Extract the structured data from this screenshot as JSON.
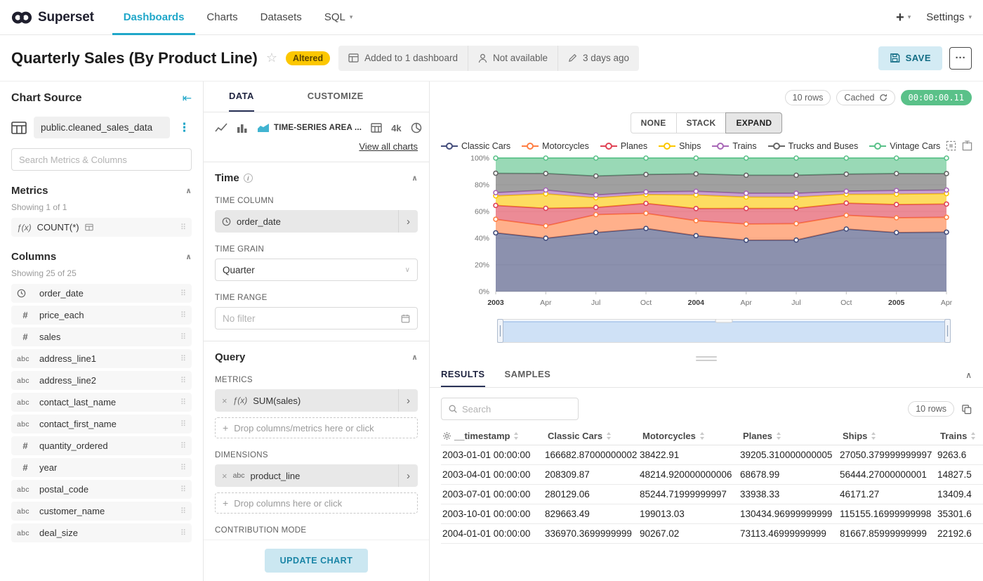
{
  "navbar": {
    "brand": "Superset",
    "items": [
      {
        "label": "Dashboards",
        "active": true
      },
      {
        "label": "Charts",
        "active": false
      },
      {
        "label": "Datasets",
        "active": false
      },
      {
        "label": "SQL",
        "active": false,
        "caret": true
      }
    ],
    "settings_label": "Settings"
  },
  "header": {
    "title": "Quarterly Sales (By Product Line)",
    "altered_badge": "Altered",
    "dashboard_info": "Added to 1 dashboard",
    "availability": "Not available",
    "last_modified": "3 days ago",
    "save_label": "SAVE",
    "more_label": "···"
  },
  "datasource_panel": {
    "title": "Chart Source",
    "dataset_name": "public.cleaned_sales_data",
    "search_placeholder": "Search Metrics & Columns",
    "metrics": {
      "title": "Metrics",
      "showing": "Showing 1 of 1",
      "items": [
        {
          "label": "COUNT(*)"
        }
      ]
    },
    "columns": {
      "title": "Columns",
      "showing": "Showing 25 of 25",
      "items": [
        {
          "name": "order_date",
          "type": "time"
        },
        {
          "name": "price_each",
          "type": "number"
        },
        {
          "name": "sales",
          "type": "number"
        },
        {
          "name": "address_line1",
          "type": "text"
        },
        {
          "name": "address_line2",
          "type": "text"
        },
        {
          "name": "contact_last_name",
          "type": "text"
        },
        {
          "name": "contact_first_name",
          "type": "text"
        },
        {
          "name": "quantity_ordered",
          "type": "number"
        },
        {
          "name": "year",
          "type": "number"
        },
        {
          "name": "postal_code",
          "type": "text"
        },
        {
          "name": "customer_name",
          "type": "text"
        },
        {
          "name": "deal_size",
          "type": "text"
        }
      ]
    }
  },
  "controls_panel": {
    "tabs": [
      "DATA",
      "CUSTOMIZE"
    ],
    "viz_selector": {
      "selected_label": "TIME-SERIES AREA ...",
      "kpi_label": "4k",
      "view_all": "View all charts"
    },
    "time_section": {
      "title": "Time",
      "time_column_label": "TIME COLUMN",
      "time_column_value": "order_date",
      "time_grain_label": "TIME GRAIN",
      "time_grain_value": "Quarter",
      "time_range_label": "TIME RANGE",
      "time_range_value": "No filter"
    },
    "query_section": {
      "title": "Query",
      "metrics_label": "METRICS",
      "metric_value": "SUM(sales)",
      "metrics_dropzone": "Drop columns/metrics here or click",
      "dimensions_label": "DIMENSIONS",
      "dimension_value": "product_line",
      "dimensions_dropzone": "Drop columns here or click",
      "contribution_label": "CONTRIBUTION MODE"
    },
    "update_chart_label": "UPDATE CHART"
  },
  "chart_panel": {
    "rows_badge": "10 rows",
    "cached_badge": "Cached",
    "timer": "00:00:00.11",
    "stack_controls": [
      {
        "label": "NONE",
        "active": false
      },
      {
        "label": "STACK",
        "active": false
      },
      {
        "label": "EXPAND",
        "active": true
      }
    ]
  },
  "results_panel": {
    "tabs": [
      "RESULTS",
      "SAMPLES"
    ],
    "search_placeholder": "Search",
    "rows_badge": "10 rows",
    "table": {
      "headers": [
        "__timestamp",
        "Classic Cars",
        "Motorcycles",
        "Planes",
        "Ships",
        "Trains"
      ],
      "rows": [
        [
          "2003-01-01 00:00:00",
          "166682.87000000002",
          "38422.91",
          "39205.310000000005",
          "27050.379999999997",
          "9263.6"
        ],
        [
          "2003-04-01 00:00:00",
          "208309.87",
          "48214.920000000006",
          "68678.99",
          "56444.27000000001",
          "14827.5"
        ],
        [
          "2003-07-01 00:00:00",
          "280129.06",
          "85244.71999999997",
          "33938.33",
          "46171.27",
          "13409.4"
        ],
        [
          "2003-10-01 00:00:00",
          "829663.49",
          "199013.03",
          "130434.96999999999",
          "115155.16999999998",
          "35301.6"
        ],
        [
          "2004-01-01 00:00:00",
          "336970.3699999999",
          "90267.02",
          "73113.46999999999",
          "81667.85999999999",
          "22192.6"
        ]
      ]
    }
  },
  "chart_data": {
    "type": "area",
    "stacking": "expand",
    "x_tick_labels": [
      "2003",
      "Apr",
      "Jul",
      "Oct",
      "2004",
      "Apr",
      "Jul",
      "Oct",
      "2005",
      "Apr"
    ],
    "y_ticks": [
      0,
      20,
      40,
      60,
      80,
      100
    ],
    "y_unit": "%",
    "ylim": [
      0,
      100
    ],
    "legend_position": "top",
    "grid": true,
    "series": [
      {
        "name": "Classic Cars",
        "color": "#454e7c",
        "values": [
          166682.87,
          208309.87,
          280129.06,
          829663.49,
          336970.37,
          270000,
          285000,
          820000,
          400000,
          344000
        ]
      },
      {
        "name": "Motorcycles",
        "color": "#ff7f44",
        "values": [
          38422.91,
          48214.92,
          85244.72,
          199013.03,
          90267.02,
          85000,
          91000,
          180000,
          100000,
          86000
        ]
      },
      {
        "name": "Planes",
        "color": "#e04355",
        "values": [
          39205.31,
          68678.99,
          33938.33,
          130434.97,
          73113.47,
          82000,
          85000,
          160000,
          90000,
          77000
        ]
      },
      {
        "name": "Ships",
        "color": "#fcc700",
        "values": [
          27050.38,
          56444.27,
          46171.27,
          115155.17,
          81667.86,
          60000,
          62000,
          115000,
          70000,
          60000
        ]
      },
      {
        "name": "Trains",
        "color": "#a868b7",
        "values": [
          9263.6,
          14827.5,
          13409.4,
          35301.6,
          22192.6,
          20000,
          21000,
          40000,
          25000,
          21000
        ]
      },
      {
        "name": "Trucks and Buses",
        "color": "#666666",
        "values": [
          55000,
          65000,
          90000,
          230000,
          105000,
          95000,
          100000,
          225000,
          115000,
          95000
        ]
      },
      {
        "name": "Vintage Cars",
        "color": "#5ac189",
        "values": [
          43000,
          60000,
          85000,
          215000,
          95000,
          90000,
          95000,
          210000,
          105000,
          90000
        ]
      }
    ]
  },
  "colors": {
    "brand": "#20a7c9",
    "altered_badge_bg": "#fcc700",
    "timer_badge_bg": "#5ac189"
  },
  "icons": {
    "favorite-star": "☆",
    "kebab-menu": "⋮",
    "collapse-left": "⇤",
    "drag-handle": "⠿",
    "caret-down": "▾",
    "chevron-up": "∧",
    "chevron-down": "∨",
    "caret-right": "›",
    "close": "×",
    "plus": "+"
  }
}
